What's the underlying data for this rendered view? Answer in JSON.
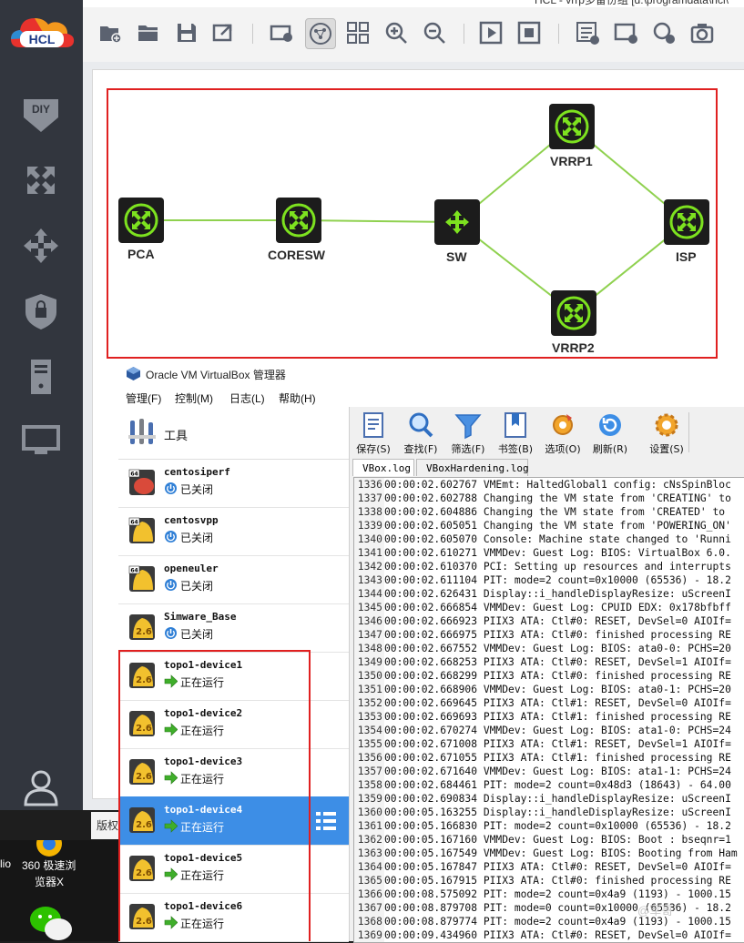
{
  "hcl": {
    "title_fragment": "HCL - vrrp多备份组 [d:\\programdata\\hcl\\"
  },
  "sidebar_icons": [
    "diy-icon",
    "network-device-icon",
    "router-icon",
    "firewall-icon",
    "server-icon",
    "terminal-icon",
    "user-icon"
  ],
  "toolbar_icons": [
    "new-project-icon",
    "open-folder-icon",
    "save-icon",
    "export-icon",
    "camera-view-icon",
    "topology-icon",
    "grid-icon",
    "zoom-in-icon",
    "zoom-out-icon",
    "play-icon",
    "stop-icon",
    "add-list-icon",
    "add-device-icon",
    "add-node-icon",
    "screenshot-icon"
  ],
  "topology": {
    "devices": [
      {
        "id": "pca",
        "label": "PCA",
        "type": "switch"
      },
      {
        "id": "coresw",
        "label": "CORESW",
        "type": "switch"
      },
      {
        "id": "sw",
        "label": "SW",
        "type": "router"
      },
      {
        "id": "vrrp1",
        "label": "VRRP1",
        "type": "switch"
      },
      {
        "id": "vrrp2",
        "label": "VRRP2",
        "type": "switch"
      },
      {
        "id": "isp",
        "label": "ISP",
        "type": "switch"
      }
    ],
    "links": [
      [
        "pca",
        "coresw"
      ],
      [
        "coresw",
        "sw"
      ],
      [
        "sw",
        "vrrp1"
      ],
      [
        "sw",
        "vrrp2"
      ],
      [
        "vrrp1",
        "isp"
      ],
      [
        "vrrp2",
        "isp"
      ]
    ],
    "link_color": "#8fd14f"
  },
  "copyright_label": "版权",
  "desktop": {
    "browser_label_line1": "360 极速浏",
    "browser_label_line2": "览器X",
    "left_fragment": "lio"
  },
  "vbox": {
    "window_title": "Oracle VM VirtualBox 管理器",
    "menu": [
      "管理(F)",
      "控制(M)",
      "日志(L)",
      "帮助(H)"
    ],
    "tools_label": "工具",
    "vms": [
      {
        "name": "centosiperf",
        "status": "已关闭",
        "state": "off",
        "badge": "64",
        "color": "#d94a3a"
      },
      {
        "name": "centosvpp",
        "status": "已关闭",
        "state": "off",
        "badge": "64",
        "color": "#f2c12e"
      },
      {
        "name": "openeuler",
        "status": "已关闭",
        "state": "off",
        "badge": "64",
        "color": "#f2c12e"
      },
      {
        "name": "Simware_Base",
        "status": "已关闭",
        "state": "off",
        "badge": "2.6",
        "color": "#f2c12e"
      },
      {
        "name": "topo1-device1",
        "status": "正在运行",
        "state": "running",
        "badge": "2.6",
        "color": "#f2c12e"
      },
      {
        "name": "topo1-device2",
        "status": "正在运行",
        "state": "running",
        "badge": "2.6",
        "color": "#f2c12e"
      },
      {
        "name": "topo1-device3",
        "status": "正在运行",
        "state": "running",
        "badge": "2.6",
        "color": "#f2c12e"
      },
      {
        "name": "topo1-device4",
        "status": "正在运行",
        "state": "running",
        "badge": "2.6",
        "color": "#f2c12e",
        "selected": true
      },
      {
        "name": "topo1-device5",
        "status": "正在运行",
        "state": "running",
        "badge": "2.6",
        "color": "#f2c12e"
      },
      {
        "name": "topo1-device6",
        "status": "正在运行",
        "state": "running",
        "badge": "2.6",
        "color": "#f2c12e"
      }
    ],
    "log_toolbar": [
      {
        "label": "保存(S)",
        "icon": "save-log-icon"
      },
      {
        "label": "查找(F)",
        "icon": "find-icon"
      },
      {
        "label": "筛选(F)",
        "icon": "filter-icon"
      },
      {
        "label": "书签(B)",
        "icon": "bookmark-icon"
      },
      {
        "label": "选项(O)",
        "icon": "options-icon"
      },
      {
        "label": "刷新(R)",
        "icon": "refresh-icon"
      },
      {
        "label": "设置(S)",
        "icon": "settings-icon"
      }
    ],
    "log_tabs": [
      "VBox.log",
      "VBoxHardening.log"
    ],
    "log_lines": [
      {
        "n": "1336",
        "t": "00:00:02.602767 VMEmt: HaltedGlobal1 config: cNsSpinBloc"
      },
      {
        "n": "1337",
        "t": "00:00:02.602788 Changing the VM state from 'CREATING' to"
      },
      {
        "n": "1338",
        "t": "00:00:02.604886 Changing the VM state from 'CREATED' to"
      },
      {
        "n": "1339",
        "t": "00:00:02.605051 Changing the VM state from 'POWERING_ON'"
      },
      {
        "n": "1340",
        "t": "00:00:02.605070 Console: Machine state changed to 'Runni"
      },
      {
        "n": "1341",
        "t": "00:00:02.610271 VMMDev: Guest Log: BIOS: VirtualBox 6.0."
      },
      {
        "n": "1342",
        "t": "00:00:02.610370 PCI: Setting up resources and interrupts"
      },
      {
        "n": "1343",
        "t": "00:00:02.611104 PIT: mode=2 count=0x10000 (65536) - 18.2"
      },
      {
        "n": "1344",
        "t": "00:00:02.626431 Display::i_handleDisplayResize: uScreenI"
      },
      {
        "n": "1345",
        "t": "00:00:02.666854 VMMDev: Guest Log: CPUID EDX: 0x178bfbff"
      },
      {
        "n": "1346",
        "t": "00:00:02.666923 PIIX3 ATA: Ctl#0: RESET, DevSel=0 AIOIf="
      },
      {
        "n": "1347",
        "t": "00:00:02.666975 PIIX3 ATA: Ctl#0: finished processing RE"
      },
      {
        "n": "1348",
        "t": "00:00:02.667552 VMMDev: Guest Log: BIOS: ata0-0: PCHS=20"
      },
      {
        "n": "1349",
        "t": "00:00:02.668253 PIIX3 ATA: Ctl#0: RESET, DevSel=1 AIOIf="
      },
      {
        "n": "1350",
        "t": "00:00:02.668299 PIIX3 ATA: Ctl#0: finished processing RE"
      },
      {
        "n": "1351",
        "t": "00:00:02.668906 VMMDev: Guest Log: BIOS: ata0-1: PCHS=20"
      },
      {
        "n": "1352",
        "t": "00:00:02.669645 PIIX3 ATA: Ctl#1: RESET, DevSel=0 AIOIf="
      },
      {
        "n": "1353",
        "t": "00:00:02.669693 PIIX3 ATA: Ctl#1: finished processing RE"
      },
      {
        "n": "1354",
        "t": "00:00:02.670274 VMMDev: Guest Log: BIOS: ata1-0: PCHS=24"
      },
      {
        "n": "1355",
        "t": "00:00:02.671008 PIIX3 ATA: Ctl#1: RESET, DevSel=1 AIOIf="
      },
      {
        "n": "1356",
        "t": "00:00:02.671055 PIIX3 ATA: Ctl#1: finished processing RE"
      },
      {
        "n": "1357",
        "t": "00:00:02.671640 VMMDev: Guest Log: BIOS: ata1-1: PCHS=24"
      },
      {
        "n": "1358",
        "t": "00:00:02.684461 PIT: mode=2 count=0x48d3 (18643) - 64.00"
      },
      {
        "n": "1359",
        "t": "00:00:02.690834 Display::i_handleDisplayResize: uScreenI"
      },
      {
        "n": "1360",
        "t": "00:00:05.163255 Display::i_handleDisplayResize: uScreenI"
      },
      {
        "n": "1361",
        "t": "00:00:05.166830 PIT: mode=2 count=0x10000 (65536) - 18.2"
      },
      {
        "n": "1362",
        "t": "00:00:05.167160 VMMDev: Guest Log: BIOS: Boot : bseqnr=1"
      },
      {
        "n": "1363",
        "t": "00:00:05.167549 VMMDev: Guest Log: BIOS: Booting from Ham"
      },
      {
        "n": "1364",
        "t": "00:00:05.167847 PIIX3 ATA: Ctl#0: RESET, DevSel=0 AIOIf="
      },
      {
        "n": "1365",
        "t": "00:00:05.167915 PIIX3 ATA: Ctl#0: finished processing RE"
      },
      {
        "n": "1366",
        "t": "00:00:08.575092 PIT: mode=2 count=0x4a9 (1193) - 1000.15"
      },
      {
        "n": "1367",
        "t": "00:00:08.879708 PIT: mode=0 count=0x10000 (65536) - 18.2"
      },
      {
        "n": "1368",
        "t": "00:00:08.879774 PIT: mode=2 count=0x4a9 (1193) - 1000.15"
      },
      {
        "n": "1369",
        "t": "00:00:09.434960 PIIX3 ATA: Ctl#0: RESET, DevSel=0 AIOIf="
      }
    ]
  },
  "watermark": "@军哥"
}
